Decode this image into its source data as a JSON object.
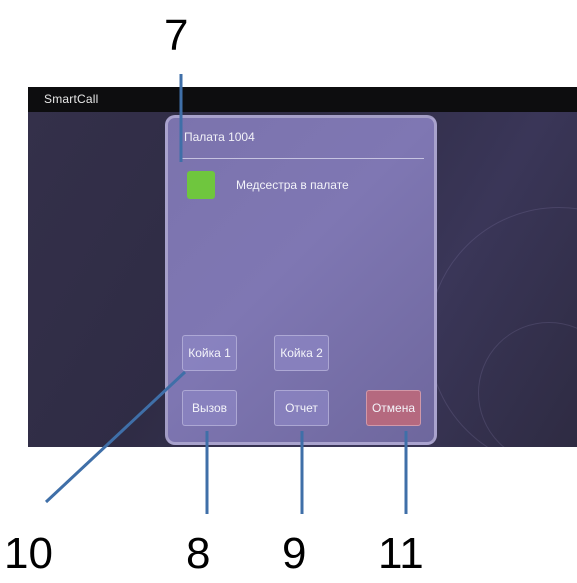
{
  "callouts": {
    "n7": "7",
    "n10": "10",
    "n8": "8",
    "n9": "9",
    "n11": "11"
  },
  "app": {
    "brand": "SmartCall"
  },
  "dialog": {
    "title": "Палата 1004",
    "status_text": "Медсестра в палате",
    "status_color": "#6fc63e",
    "buttons": {
      "bed1": "Койка 1",
      "bed2": "Койка 2",
      "call": "Вызов",
      "report": "Отчет",
      "cancel": "Отмена"
    }
  },
  "colors": {
    "callout_line": "#3f6fa8",
    "dialog": "#7b73ad",
    "cancel_button": "#b5697f"
  }
}
